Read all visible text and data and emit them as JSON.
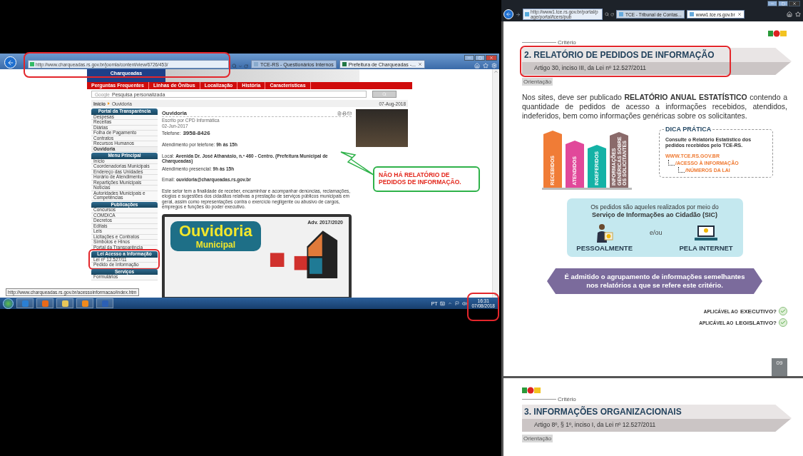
{
  "left_window": {
    "address": "http://www.charqueadas.rs.gov.br/joomla/content/view/6726/453/",
    "tabs": [
      {
        "label": "TCE-RS - Questionários Internos",
        "selected": false
      },
      {
        "label": "Prefeitura de Charqueadas -...",
        "selected": true
      }
    ],
    "site": {
      "logo_text": "Charqueadas",
      "nav": [
        "Perguntas Frequentes",
        "Linhas de Ônibus",
        "Localização",
        "História",
        "Características"
      ],
      "search": {
        "brand": "Google",
        "placeholder": "Pesquisa personalizada"
      },
      "breadcrumb": {
        "items": [
          "Início",
          "Ouvidoria"
        ],
        "date": "07-Aug-2018"
      },
      "sidebar": [
        {
          "heading": "Portal da Transparência",
          "highlighted": false,
          "items": [
            {
              "label": "Despesas",
              "selected": false
            },
            {
              "label": "Receitas",
              "selected": false
            },
            {
              "label": "Diárias",
              "selected": false
            },
            {
              "label": "Folha de Pagamento",
              "selected": false
            },
            {
              "label": "Contratos",
              "selected": false
            },
            {
              "label": "Recursos Humanos",
              "selected": false
            },
            {
              "label": "Ouvidoria",
              "selected": true
            }
          ]
        },
        {
          "heading": "Menu Principal",
          "highlighted": false,
          "items": [
            {
              "label": "Início",
              "selected": false
            },
            {
              "label": "Coordenadorias Municipais",
              "selected": false
            },
            {
              "label": "Endereço das Unidades",
              "selected": false
            },
            {
              "label": "Horário de Atendimento",
              "selected": false
            },
            {
              "label": "Repartições Municipais",
              "selected": false
            },
            {
              "label": "Notícias",
              "selected": false
            },
            {
              "label": "Autoridades Municipais e Competências",
              "selected": false
            }
          ]
        },
        {
          "heading": "Publicações",
          "highlighted": false,
          "items": [
            {
              "label": "Concursos",
              "selected": false
            },
            {
              "label": "COMDICA",
              "selected": false
            },
            {
              "label": "Decretos",
              "selected": false
            },
            {
              "label": "Editais",
              "selected": false
            },
            {
              "label": "Leis",
              "selected": false
            },
            {
              "label": "Licitações e Contratos",
              "selected": false
            },
            {
              "label": "Símbolos e Hinos",
              "selected": false
            },
            {
              "label": "Portal da Transparência",
              "selected": false
            }
          ]
        },
        {
          "heading": "Lei Acesso a Informação",
          "highlighted": true,
          "items": [
            {
              "label": "Lei nº 12.527/11",
              "selected": false
            },
            {
              "label": "Pedido de Informação",
              "selected": false
            }
          ]
        },
        {
          "heading": "Serviços",
          "highlighted": false,
          "items": [
            {
              "label": "Formulários",
              "selected": false
            }
          ]
        }
      ],
      "article": {
        "title": "Ouvidoria",
        "byline": "Escrito por CPD Informática",
        "date": "02-Jun-2017",
        "phone_label": "Telefone:",
        "phone": "3958-8426",
        "blocks": [
          [
            "Atendimento por telefone: **9h às 15h**"
          ],
          [
            "Local: **Avenida Dr. José Athanásio, n.º 460 - Centro. (Prefeitura Municipal de Charqueadas)**",
            "Atendimento presencial: **9h às 15h**"
          ],
          [
            "Email: **ouvidoria@charqueadas.rs.gov.br**"
          ]
        ],
        "body": "Este setor tem a finalidade de receber, encaminhar e acompanhar denúncias, reclamações, elogios e sugestões dos cidadãos relativas a prestação de serviços públicos municipais em geral, assim como representações contra o exercício negligente ou abusivo de cargos, empregos e funções do poder executivo."
      },
      "banner": {
        "title": "Ouvidoria",
        "subtitle": "Municipal",
        "caption": "Adv. 2017/2020"
      }
    },
    "status_url": "http://www.charqueadas.rs.gov.br/acessoinformacao/index.htm",
    "taskbar": {
      "language": "PT",
      "time": "16:31",
      "date": "07/08/2018"
    }
  },
  "callout": "NÃO HÁ RELATÓRIO DE PEDIDOS DE INFORMAÇÃO.",
  "right_window": {
    "address": "http://www1.tce.rs.gov.br/portal/page/portal/tcers/pub",
    "tabs": [
      {
        "label": "TCE - Tribunal de Contas...",
        "selected": false
      },
      {
        "label": "www1.tce.rs.gov.br",
        "selected": true
      }
    ],
    "pages": [
      {
        "criterion": "Critério",
        "highlighted": true,
        "title": "2. RELATÓRIO DE PEDIDOS DE INFORMAÇÃO",
        "subtitle": "Artigo 30, inciso III, da Lei nº 12.527/2011",
        "tag": "Orientação",
        "paragraph": "Nos sites, deve ser publicado **RELATÓRIO ANUAL ESTATÍSTICO** contendo a quantidade de pedidos de acesso a informações recebidos, atendidos, indeferidos, bem como informações genéricas sobre os solicitantes.",
        "bars": [
          {
            "label": "RECEBIDOS",
            "color": "#f07c36"
          },
          {
            "label": "ATENDIDOS",
            "color": "#e1489a"
          },
          {
            "label": "INDEFERIDOS",
            "color": "#14b2a6"
          },
          {
            "label": "INFORMAÇÕES GENÉRICAS SOBRE OS SOLICITANTES",
            "color": "#8a6a6a"
          }
        ],
        "tip": {
          "title": "DICA PRÁTICA",
          "text": "Consulte o Relatório Estatístico dos pedidos recebidos pelo TCE-RS.",
          "path": {
            "label": "WWW.TCE.RS.GOV.BR",
            "children": [
              {
                "label": "/ACESSO À INFORMAÇÃO",
                "children": [
                  {
                    "label": "/NÚMEROS DA LAI"
                  }
                ]
              }
            ]
          }
        },
        "sic": {
          "text": "Os pedidos são aqueles realizados por meio do **Serviço de Informações ao Cidadão (SIC)**",
          "options": [
            {
              "kind": "person",
              "label": "PESSOALMENTE"
            },
            {
              "kind": "laptop",
              "label": "PELA INTERNET"
            }
          ],
          "connector": "e/ou"
        },
        "note": "É admitido o agrupamento de informações semelhantes nos relatórios a que se refere este critério.",
        "applicability": [
          {
            "prefix": "APLICÁVEL AO",
            "target": "EXECUTIVO?",
            "checked": true
          },
          {
            "prefix": "APLICÁVEL AO",
            "target": "LEGISLATIVO?",
            "checked": true
          }
        ],
        "page_number": "09"
      },
      {
        "criterion": "Critério",
        "highlighted": false,
        "title": "3. INFORMAÇÕES ORGANIZACIONAIS",
        "subtitle": "Artigo 8º, § 1º, inciso I, da Lei nº 12.527/2011",
        "tag": "Orientação"
      }
    ]
  }
}
